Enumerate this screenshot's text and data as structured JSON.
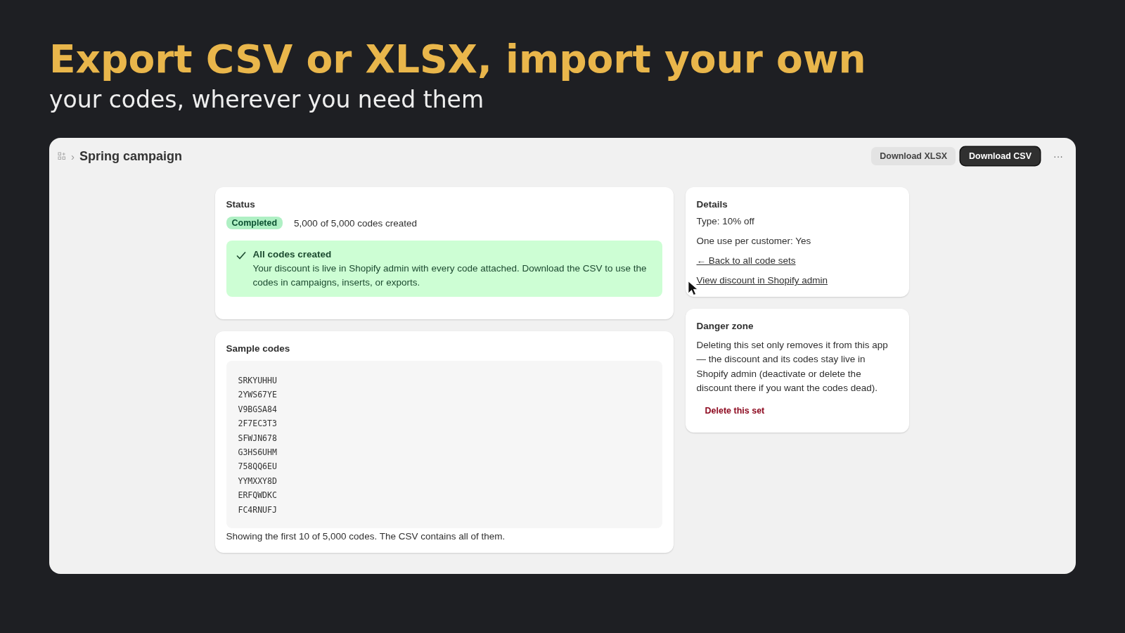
{
  "headline": "Export CSV or XLSX, import your own",
  "subheadline": "your codes, wherever you need them",
  "app": {
    "breadcrumb_separator": "›",
    "title": "Spring campaign",
    "actions": [
      {
        "label": "Download XLSX",
        "kind": "secondary"
      },
      {
        "label": "Download CSV",
        "kind": "primary"
      }
    ],
    "more_menu": "···",
    "status_card": {
      "title": "Status",
      "badge": "Completed",
      "progress_text": "5,000 of 5,000 codes created",
      "banner": {
        "title": "All codes created",
        "text": "Your discount is live in Shopify admin with every code attached. Download the CSV to use the codes in campaigns, inserts, or exports."
      }
    },
    "sample_card": {
      "title": "Sample codes",
      "codes": [
        "SRKYUHHU",
        "2YWS67YE",
        "V9BGSA84",
        "2F7EC3T3",
        "SFWJN678",
        "G3HS6UHM",
        "758QQ6EU",
        "YYMXXY8D",
        "ERFQWDKC",
        "FC4RNUFJ"
      ],
      "footer": "Showing the first 10 of 5,000 codes. The CSV contains all of them."
    },
    "details_card": {
      "title": "Details",
      "items": [
        {
          "text": "Type: 10% off",
          "kind": "text"
        },
        {
          "text": "One use per customer: Yes",
          "kind": "text"
        },
        {
          "text": "← Back to all code sets",
          "kind": "link"
        },
        {
          "text": "View discount in Shopify admin",
          "kind": "link"
        }
      ]
    },
    "danger_card": {
      "title": "Danger zone",
      "text": "Deleting this set only removes it from this app — the discount and its codes stay live in Shopify admin (deactivate or delete the discount there if you want the codes dead).",
      "action": "Delete this set"
    }
  }
}
